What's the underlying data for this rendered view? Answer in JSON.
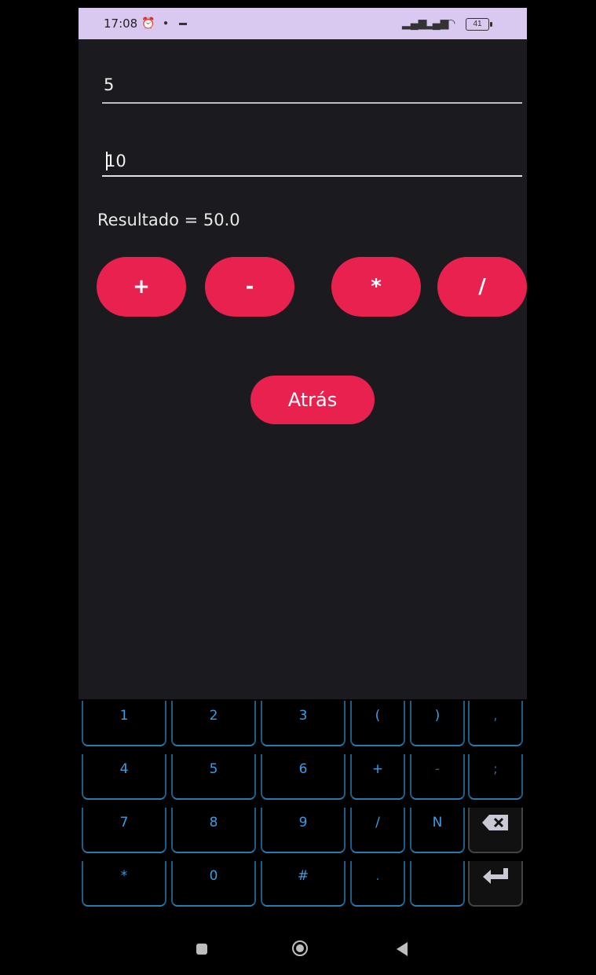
{
  "status_bar": {
    "time": "17:08",
    "battery": "41",
    "icons": [
      "alarm-icon",
      "notification-icon",
      "signal-icon",
      "wifi-icon",
      "battery-icon"
    ]
  },
  "form": {
    "field1_value": "5",
    "field2_value": "10",
    "result_text": "Resultado = 50.0"
  },
  "operations": {
    "add_label": "+",
    "subtract_label": "-",
    "multiply_label": "*",
    "divide_label": "/"
  },
  "back_label": "Atrás",
  "keyboard": {
    "rows": [
      [
        "1",
        "2",
        "3",
        "(",
        ")",
        ","
      ],
      [
        "4",
        "5",
        "6",
        "+",
        "-",
        ";"
      ],
      [
        "7",
        "8",
        "9",
        "/",
        "N",
        "backspace-icon"
      ],
      [
        "*",
        "0",
        "#",
        ".",
        "",
        "enter-icon"
      ]
    ]
  },
  "colors": {
    "accent": "#e8214f",
    "background": "#1b1a1f",
    "status_bar": "#d9c9f0",
    "key_text": "#3d9de0"
  }
}
